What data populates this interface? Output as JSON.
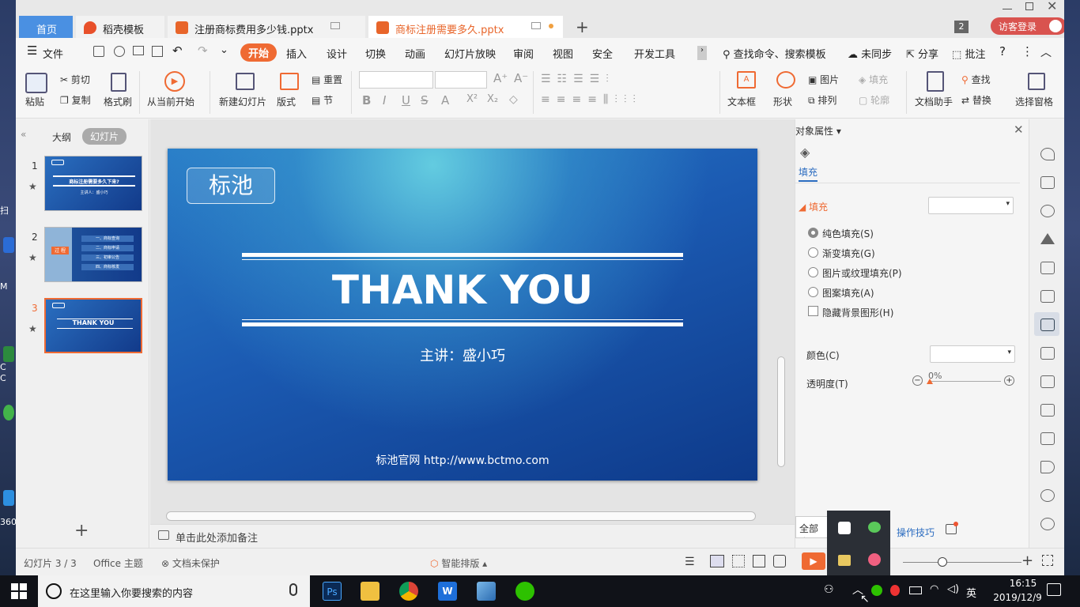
{
  "tabs": {
    "home": "首页",
    "template": "稻壳模板",
    "file1": "注册商标费用多少钱.pptx",
    "file2": "商标注册需要多久.pptx",
    "counter": "2",
    "login": "访客登录"
  },
  "menu": {
    "file": "文件",
    "start": "开始",
    "insert": "插入",
    "design": "设计",
    "switch": "切换",
    "animate": "动画",
    "slideshow": "幻灯片放映",
    "review": "审阅",
    "view": "视图",
    "security": "安全",
    "devtools": "开发工具",
    "search": "查找命令、搜索模板",
    "sync": "未同步",
    "share": "分享",
    "comment": "批注",
    "help": "?"
  },
  "ribbon": {
    "paste": "粘贴",
    "cut": "剪切",
    "copy": "复制",
    "format_painter": "格式刷",
    "from_current": "从当前开始",
    "new_slide": "新建幻灯片",
    "layout": "版式",
    "reset": "重置",
    "section": "节",
    "textbox": "文本框",
    "shape": "形状",
    "arrange": "排列",
    "picture": "图片",
    "fill": "填充",
    "outline": "轮廓",
    "doc_helper": "文档助手",
    "find": "查找",
    "replace": "替换",
    "select_pane": "选择窗格"
  },
  "left": {
    "outline_tab": "大纲",
    "slides_tab": "幻灯片",
    "nums": [
      "1",
      "2",
      "3"
    ],
    "add": "+"
  },
  "slide": {
    "logo": "标池",
    "title": "THANK YOU",
    "presenter": "主讲：盛小巧",
    "website": "标池官网 http://www.bctmo.com"
  },
  "thumbs": {
    "t1_title": "商标注册需要多久下来?",
    "t1_sub": "主讲人：盛小巧",
    "t2_tag": "过 程",
    "t2_item1": "一、商标查询",
    "t2_item2": "二、商标申请",
    "t2_item3": "三、初审公告",
    "t2_item4": "四、商标核发",
    "t3_title": "THANK YOU"
  },
  "props": {
    "header": "对象属性",
    "tab_fill": "填充",
    "section_fill": "填充",
    "solid": "纯色填充(S)",
    "gradient": "渐变填充(G)",
    "picture": "图片或纹理填充(P)",
    "pattern": "图案填充(A)",
    "hide_bg": "隐藏背景图形(H)",
    "color": "颜色(C)",
    "transparency": "透明度(T)",
    "trans_value": "0%",
    "apply_all": "全部应",
    "tips": "操作技巧"
  },
  "notes": {
    "placeholder": "单击此处添加备注"
  },
  "status": {
    "slide_count": "幻灯片 3 / 3",
    "theme": "Office 主题",
    "protect": "文档未保护",
    "smart_layout": "智能排版"
  },
  "taskbar": {
    "search": "在这里输入你要搜索的内容",
    "time": "16:15",
    "date": "2019/12/9",
    "ime": "英"
  },
  "desktop": {
    "labels": [
      "扫",
      "M",
      "C",
      "C",
      "360"
    ]
  }
}
